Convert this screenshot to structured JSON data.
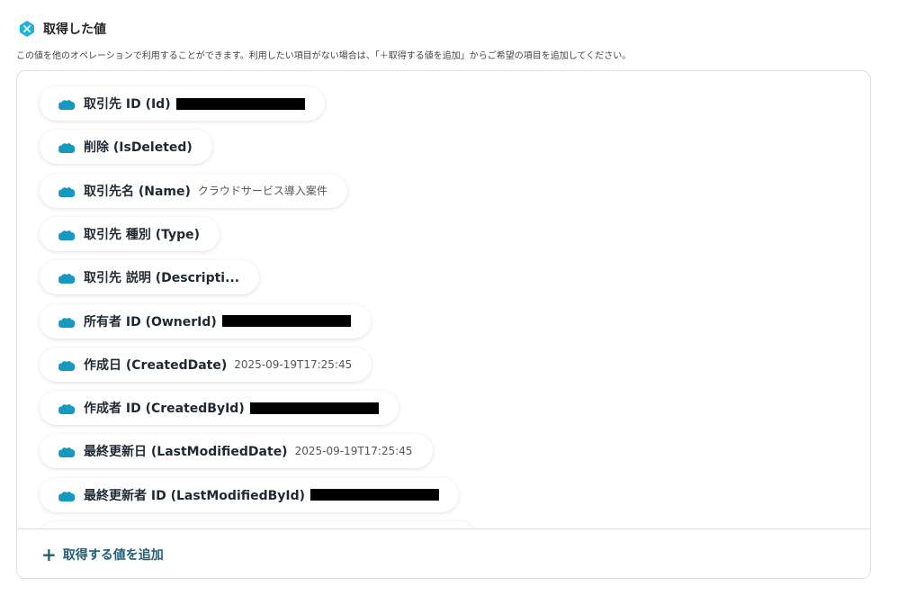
{
  "header": {
    "title": "取得した値",
    "icon": "yoom-x-hexagon-icon",
    "icon_color": "#1ab4d8"
  },
  "description": "この値を他のオペレーションで利用することができます。利用したい項目がない場合は、「＋取得する値を追加」からご希望の項目を追加してください。",
  "items": [
    {
      "label": "取引先 ID (Id)",
      "value": "",
      "redacted": true
    },
    {
      "label": "削除 (IsDeleted)",
      "value": "",
      "redacted": false
    },
    {
      "label": "取引先名 (Name)",
      "value": "クラウドサービス導入案件",
      "redacted": false
    },
    {
      "label": "取引先 種別 (Type)",
      "value": "",
      "redacted": false
    },
    {
      "label": "取引先 説明 (Descripti...",
      "value": "",
      "redacted": false
    },
    {
      "label": "所有者 ID (OwnerId)",
      "value": "",
      "redacted": true
    },
    {
      "label": "作成日 (CreatedDate)",
      "value": "2025-09-19T17:25:45",
      "redacted": false
    },
    {
      "label": "作成者 ID (CreatedById)",
      "value": "",
      "redacted": true
    },
    {
      "label": "最終更新日 (LastModifiedDate)",
      "value": "2025-09-19T17:25:45",
      "redacted": false
    },
    {
      "label": "最終更新者 ID (LastModifiedById)",
      "value": "",
      "redacted": true
    }
  ],
  "footer": {
    "add_label": "取得する値を追加",
    "icon": "plus-icon"
  },
  "colors": {
    "salesforce_blue": "#1798c1",
    "accent": "#1f5f7a"
  }
}
